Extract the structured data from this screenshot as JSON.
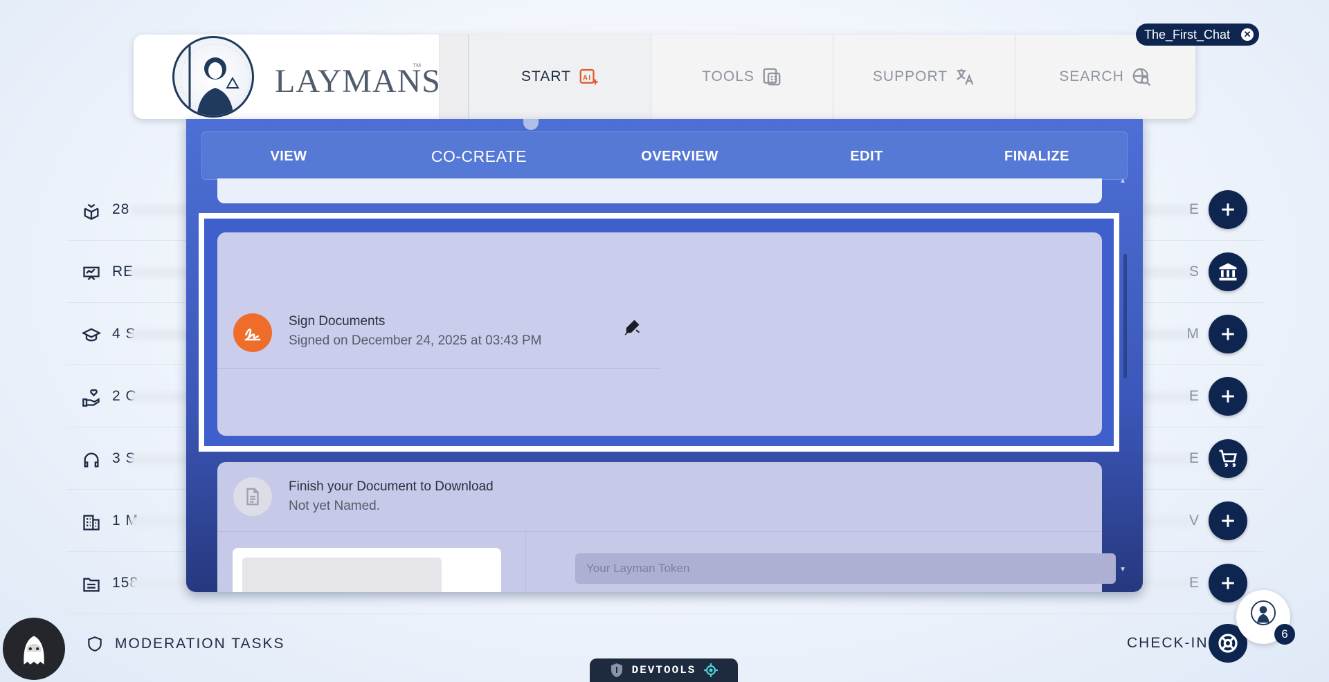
{
  "chat_chip": {
    "label": "The_First_Chat"
  },
  "logo": {
    "text": "LAYMANS",
    "tm": "™"
  },
  "nav": [
    {
      "label": "START",
      "icon": "ai-icon",
      "active": true
    },
    {
      "label": "TOOLS",
      "icon": "calculator-icon",
      "active": false
    },
    {
      "label": "SUPPORT",
      "icon": "translate-icon",
      "active": false
    },
    {
      "label": "SEARCH",
      "icon": "search-globe-icon",
      "active": false
    }
  ],
  "subtabs": [
    {
      "label": "VIEW"
    },
    {
      "label": "CO-CREATE"
    },
    {
      "label": "OVERVIEW"
    },
    {
      "label": "EDIT"
    },
    {
      "label": "FINALIZE",
      "active": true
    }
  ],
  "sign_card": {
    "title": "Sign Documents",
    "subtitle": "Signed on December 24, 2025 at 03:43 PM",
    "icon": "signature-icon",
    "action_icon": "edit-signature-icon",
    "accent": "#ef6d2b"
  },
  "finish_card": {
    "title": "Finish your Document to Download",
    "subtitle": "Not yet Named.",
    "token_placeholder": "Your Layman Token",
    "icon": "document-icon"
  },
  "background_rows": [
    {
      "text": "28",
      "icon": "box-icon",
      "right_letter": "E",
      "fab": "plus-icon"
    },
    {
      "text": "RE",
      "icon": "presentation-icon",
      "right_letter": "S",
      "fab": "bank-icon"
    },
    {
      "text": "4 S",
      "icon": "graduation-cap-icon",
      "right_letter": "M",
      "fab": "plus-icon"
    },
    {
      "text": "2 C",
      "icon": "hand-heart-icon",
      "right_letter": "E",
      "fab": "plus-icon"
    },
    {
      "text": "3 S",
      "icon": "headset-icon",
      "right_letter": "E",
      "fab": "cart-icon"
    },
    {
      "text": "1 M",
      "icon": "building-icon",
      "right_letter": "V",
      "fab": "plus-icon"
    },
    {
      "text": "158",
      "icon": "folder-icon",
      "right_letter": "E",
      "fab": "plus-icon"
    }
  ],
  "bottom": {
    "moderation_label": "MODERATION TASKS",
    "checkin_label": "CHECK-IN",
    "devtools_label": "DEVTOOLS",
    "badge_count": "6"
  },
  "colors": {
    "navy": "#0e2550",
    "panel_blue": "#4d6fd6",
    "accent_orange": "#ef6d2b"
  }
}
